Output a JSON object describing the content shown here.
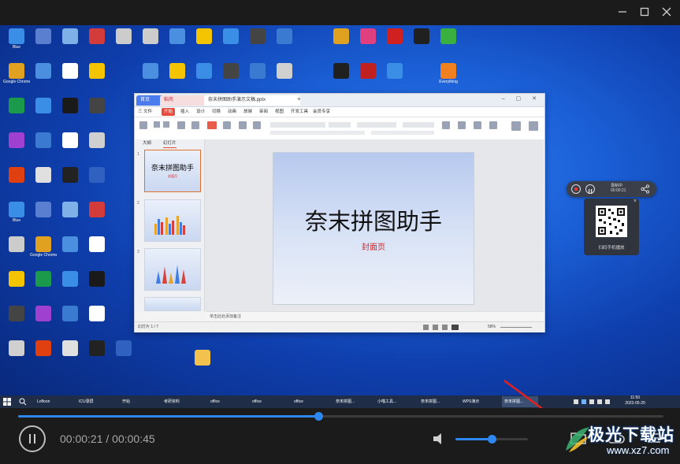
{
  "window": {
    "minimize_icon": "minimize-icon",
    "maximize_icon": "maximize-icon",
    "close_icon": "close-icon"
  },
  "desktop": {
    "icons": [
      {
        "label": "Blue",
        "color": "#3a8ee6"
      },
      {
        "label": "",
        "color": "#5a7fd0"
      },
      {
        "label": "",
        "color": "#7fb0e8"
      },
      {
        "label": "",
        "color": "#d43c3c"
      },
      {
        "label": "",
        "color": "#cccccc"
      },
      {
        "label": "Google Chrome",
        "color": "#e0a020"
      },
      {
        "label": "",
        "color": "#4a8fe0"
      },
      {
        "label": "",
        "color": "#ffffff"
      },
      {
        "label": "",
        "color": "#f5c400"
      },
      {
        "label": "",
        "color": "#1a9a4a"
      },
      {
        "label": "",
        "color": "#3a8ee6"
      },
      {
        "label": "",
        "color": "#1a1a1a"
      },
      {
        "label": "",
        "color": "#444444"
      },
      {
        "label": "",
        "color": "#a040d0"
      },
      {
        "label": "",
        "color": "#3a7ad0"
      },
      {
        "label": "",
        "color": "#ffffff"
      },
      {
        "label": "",
        "color": "#d0d0d0"
      },
      {
        "label": "",
        "color": "#e04010"
      },
      {
        "label": "",
        "color": "#e0e0e0"
      },
      {
        "label": "",
        "color": "#222222"
      },
      {
        "label": "",
        "color": "#3060c0"
      }
    ],
    "right_icons": [
      {
        "label": "",
        "color": "#e0a020"
      },
      {
        "label": "",
        "color": "#e04080"
      },
      {
        "label": "",
        "color": "#d02020"
      },
      {
        "label": "",
        "color": "#202020"
      },
      {
        "label": "",
        "color": "#3ab040"
      },
      {
        "label": "",
        "color": "#202020"
      },
      {
        "label": "",
        "color": "#c02020"
      },
      {
        "label": "",
        "color": "#3a8ee6"
      },
      {
        "label": "Everything",
        "color": "#f08020"
      }
    ]
  },
  "wps": {
    "tabs": [
      "首页",
      "稻壳",
      "奈末拼图助手演示文稿.pptx"
    ],
    "menu": [
      "三 文件",
      "开始",
      "插入",
      "设计",
      "切换",
      "动画",
      "放映",
      "审阅",
      "视图",
      "开发工具",
      "会员专享"
    ],
    "left_tabs": [
      "大纲",
      "幻灯片"
    ],
    "slide_title": "奈末拼图助手",
    "slide_subtitle": "封面页",
    "notes": "单击此处添加备注",
    "status_left": "幻灯片 1 / 7",
    "zoom": "58%"
  },
  "recorder": {
    "label_a": "录制中",
    "label_b": "00:00:21",
    "qr_label": "扫码手机播放"
  },
  "taskbar": {
    "items": [
      "Lofloon",
      "ICU录屏",
      "开始",
      "考研资料",
      "office",
      "office",
      "office",
      "奈末拼图...",
      "小喵工具...",
      "奈末拼图...",
      "WPS演示",
      "奈末拼图..."
    ],
    "clock_time": "11:50",
    "clock_date": "2023-05-20"
  },
  "player": {
    "current_time": "00:00:21",
    "separator": "/",
    "total_time": "00:00:45",
    "progress": 0.465,
    "volume": 0.5,
    "accent": "#2e86ef"
  },
  "watermark": {
    "text": "极光下载站",
    "url": "www.xz7.com"
  }
}
